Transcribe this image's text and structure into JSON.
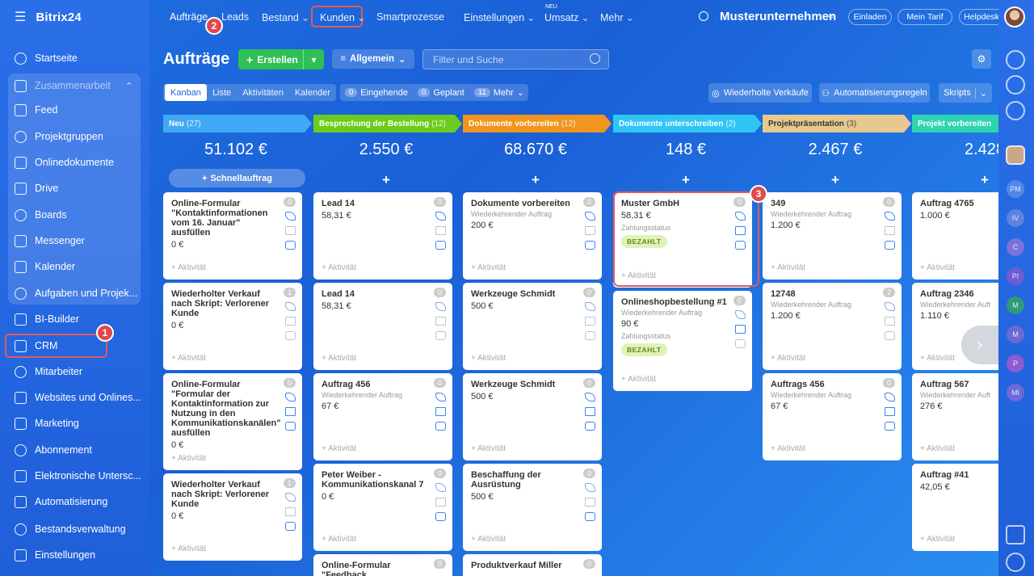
{
  "app": {
    "logo": "Bitrix24"
  },
  "sidebar": {
    "items": [
      {
        "label": "Startseite"
      },
      {
        "label": "Zusammenarbeit"
      },
      {
        "label": "Feed"
      },
      {
        "label": "Projektgruppen"
      },
      {
        "label": "Onlinedokumente"
      },
      {
        "label": "Drive"
      },
      {
        "label": "Boards"
      },
      {
        "label": "Messenger"
      },
      {
        "label": "Kalender"
      },
      {
        "label": "Aufgaben und Projek..."
      },
      {
        "label": "BI-Builder"
      },
      {
        "label": "CRM"
      },
      {
        "label": "Mitarbeiter"
      },
      {
        "label": "Websites und Onlines..."
      },
      {
        "label": "Marketing"
      },
      {
        "label": "Abonnement"
      },
      {
        "label": "Elektronische Untersc..."
      },
      {
        "label": "Automatisierung"
      },
      {
        "label": "Bestandsverwaltung"
      },
      {
        "label": "Einstellungen"
      }
    ]
  },
  "topnav": {
    "items": [
      "Aufträge",
      "Leads",
      "Bestand",
      "Kunden",
      "Smartprozesse",
      "Einstellungen",
      "Umsatz",
      "Mehr"
    ],
    "new_badge": "NEU",
    "company": "Musterunternehmen",
    "buttons": [
      "Einladen",
      "Mein Tarif",
      "Helpdesk"
    ]
  },
  "header": {
    "title": "Aufträge",
    "create_label": "Erstellen",
    "filter_label": "Allgemein",
    "search_placeholder": "Filter und Suche",
    "recurring_label": "Wiederholte Verkäufe",
    "automation_label": "Automatisierungsregeln",
    "scripts_label": "Skripts"
  },
  "views": [
    "Kanban",
    "Liste",
    "Aktivitäten",
    "Kalender"
  ],
  "counters": {
    "incoming_count": "0",
    "incoming_label": "Eingehende",
    "planned_count": "0",
    "planned_label": "Geplant",
    "more_count": "11",
    "more_label": "Mehr"
  },
  "markers": [
    "1",
    "2",
    "3"
  ],
  "columns": [
    {
      "title": "Neu",
      "count": "(27)",
      "sum": "51.102 €",
      "quick": "Schnellauftrag",
      "color": "#3fa9f5",
      "cards": [
        {
          "title": "Online-Formular \"Kontaktinformationen vom 16. Januar\" ausfüllen",
          "sub": "",
          "amount": "0 €",
          "badge": "0",
          "act": "+ Aktivität"
        },
        {
          "title": "Wiederholter Verkauf nach Skript: Verlorener Kunde",
          "sub": "",
          "amount": "0 €",
          "badge": "1",
          "act": "+ Aktivität"
        },
        {
          "title": "Online-Formular \"Formular der Kontaktinformation zur Nutzung in den Kommunikationskanälen\" ausfüllen",
          "sub": "",
          "amount": "0 €",
          "badge": "0",
          "act": "+ Aktivität"
        },
        {
          "title": "Wiederholter Verkauf nach Skript: Verlorener Kunde",
          "sub": "",
          "amount": "0 €",
          "badge": "1",
          "act": "+ Aktivität"
        }
      ]
    },
    {
      "title": "Besprechung der Bestellung",
      "count": "(12)",
      "sum": "2.550 €",
      "color": "#6ccc1e",
      "cards": [
        {
          "title": "Lead 14",
          "sub": "",
          "amount": "58,31 €",
          "badge": "0",
          "act": "+ Aktivität"
        },
        {
          "title": "Lead 14",
          "sub": "",
          "amount": "58,31 €",
          "badge": "0",
          "act": "+ Aktivität"
        },
        {
          "title": "Auftrag 456",
          "sub": "Wiederkehrender Auftrag",
          "amount": "67 €",
          "badge": "0",
          "act": "+ Aktivität"
        },
        {
          "title": "Peter Weiber - Kommunikationskanal 7",
          "sub": "",
          "amount": "0 €",
          "badge": "0",
          "act": "+ Aktivität"
        },
        {
          "title": "Online-Formular \"Feedback",
          "sub": "",
          "amount": "",
          "badge": "0",
          "act": ""
        }
      ]
    },
    {
      "title": "Dokumente vorbereiten",
      "count": "(12)",
      "sum": "68.670 €",
      "color": "#f0951e",
      "cards": [
        {
          "title": "Dokumente vorbereiten",
          "sub": "Wiederkehrender Auftrag",
          "amount": "200 €",
          "badge": "0",
          "act": "+ Aktivität"
        },
        {
          "title": "Werkzeuge Schmidt",
          "sub": "",
          "amount": "500 €",
          "badge": "0",
          "act": "+ Aktivität"
        },
        {
          "title": "Werkzeuge Schmidt",
          "sub": "",
          "amount": "500 €",
          "badge": "0",
          "act": "+ Aktivität"
        },
        {
          "title": "Beschaffung der Ausrüstung",
          "sub": "",
          "amount": "500 €",
          "badge": "0",
          "act": "+ Aktivität"
        },
        {
          "title": "Produktverkauf Miller",
          "sub": "",
          "amount": "",
          "badge": "0",
          "act": ""
        }
      ]
    },
    {
      "title": "Dokumente unterschreiben",
      "count": "(2)",
      "sum": "148 €",
      "color": "#2fc6f6",
      "cards": [
        {
          "title": "Muster GmbH",
          "sub": "",
          "amount": "58,31 €",
          "badge": "0",
          "zs": "Zahlungsstatus",
          "paid": "BEZAHLT",
          "act": "+ Aktivität"
        },
        {
          "title": "Onlineshopbestellung #1",
          "sub": "Wiederkehrender Auftrag",
          "amount": "90 €",
          "badge": "0",
          "zs": "Zahlungsstatus",
          "paid": "BEZAHLT",
          "act": "+ Aktivität"
        }
      ]
    },
    {
      "title": "Projektpräsentation",
      "count": "(3)",
      "sum": "2.467 €",
      "color": "#e7c98f",
      "cards": [
        {
          "title": "349",
          "sub": "Wiederkehrender Auftrag",
          "amount": "1.200 €",
          "badge": "0",
          "act": "+ Aktivität"
        },
        {
          "title": "12748",
          "sub": "Wiederkehrender Auftrag",
          "amount": "1.200 €",
          "badge": "2",
          "act": "+ Aktivität"
        },
        {
          "title": "Auftrags 456",
          "sub": "Wiederkehrender Auftrag",
          "amount": "67 €",
          "badge": "0",
          "act": "+ Aktivität"
        }
      ]
    },
    {
      "title": "Projekt vorbereiten",
      "count": "",
      "sum": "2.428",
      "color": "#2ed3b0",
      "cards": [
        {
          "title": "Auftrag 4765",
          "sub": "",
          "amount": "1.000 €",
          "badge": "",
          "act": "+ Aktivität"
        },
        {
          "title": "Auftrag 2346",
          "sub": "Wiederkehrender Auft",
          "amount": "1.110 €",
          "badge": "",
          "act": "+ Aktivität"
        },
        {
          "title": "Auftrag 567",
          "sub": "Wiederkehrender Auft",
          "amount": "276 €",
          "badge": "",
          "act": "+ Aktivität"
        },
        {
          "title": "Auftrag #41",
          "sub": "",
          "amount": "42,05 €",
          "badge": "",
          "act": "+ Aktivität"
        }
      ]
    }
  ],
  "rightbar_avatars": [
    "PM",
    "IV",
    "C",
    "PI",
    "M",
    "M",
    "P",
    "MI"
  ]
}
